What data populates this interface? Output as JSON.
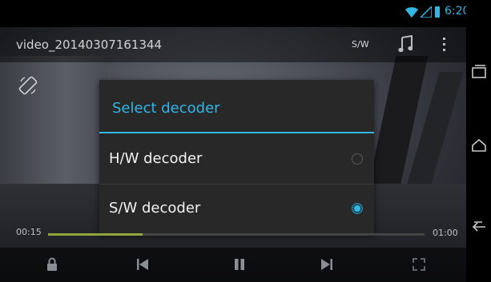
{
  "status_bar": {
    "time": "6:20",
    "accent": "#33b5e5"
  },
  "title_bar": {
    "title": "video_20140307161344",
    "decoder_label": "S/W"
  },
  "dialog": {
    "title": "Select decoder",
    "options": [
      {
        "label": "H/W decoder",
        "selected": false
      },
      {
        "label": "S/W decoder",
        "selected": true
      }
    ]
  },
  "playback": {
    "elapsed": "00:15",
    "duration": "01:00",
    "progress_fraction": 0.25
  },
  "controls": {
    "icons": [
      "lock-icon",
      "previous-icon",
      "pause-icon",
      "next-icon",
      "fullscreen-icon"
    ]
  },
  "nav_bar": {
    "icons": [
      "recents-icon",
      "home-icon",
      "back-icon"
    ]
  }
}
